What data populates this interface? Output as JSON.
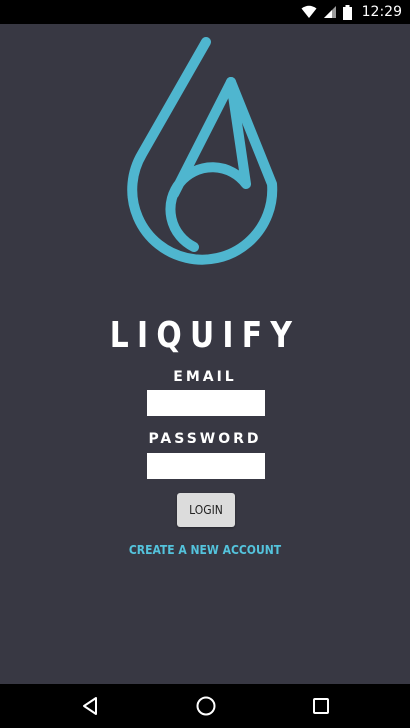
{
  "status_bar": {
    "time": "12:29",
    "icons": [
      "wifi-icon",
      "cell-signal-icon",
      "battery-icon"
    ]
  },
  "app": {
    "title": "LIQUIFY",
    "logo_icon": "water-drop-logo",
    "accent_color": "#4fb6cf",
    "background_color": "#383843"
  },
  "form": {
    "email_label": "EMAIL",
    "email_value": "",
    "email_placeholder": "",
    "password_label": "PASSWORD",
    "password_value": "",
    "password_placeholder": "",
    "login_label": "LOGIN",
    "create_account_label": "CREATE A NEW ACCOUNT",
    "link_color": "#54c3dc"
  },
  "nav_bar": {
    "icons": [
      "back-icon",
      "home-icon",
      "recents-icon"
    ]
  }
}
